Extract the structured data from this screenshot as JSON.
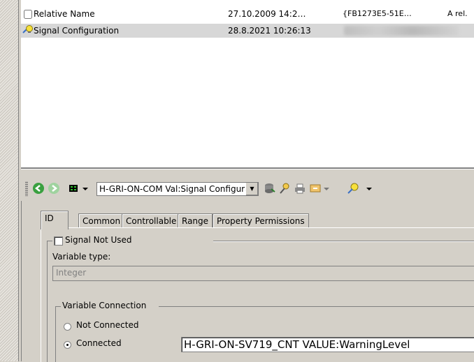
{
  "list": {
    "rows": [
      {
        "name": "Relative Name",
        "date": "27.10.2009 14:2…",
        "guid": "{FB1273E5-51E…",
        "desc": "A rel.",
        "icon": "document-icon"
      },
      {
        "name": "Signal Configuration",
        "date": "28.8.2021 10:26:13",
        "guid": "",
        "desc": "",
        "icon": "signal-config-icon"
      }
    ]
  },
  "toolbar": {
    "combo_value": "H-GRI-ON-COM Val:Signal Configurat",
    "icons": [
      "back-icon",
      "forward-icon",
      "grid-icon",
      "dropdown-arrow-icon",
      "stack-icon",
      "pin-icon",
      "printer-icon",
      "export-icon",
      "config-wand-icon"
    ]
  },
  "tabs": [
    {
      "label": "ID"
    },
    {
      "label": "Common"
    },
    {
      "label": "Controllable"
    },
    {
      "label": "Range"
    },
    {
      "label": "Property Permissions"
    }
  ],
  "panel": {
    "signal_not_used": "Signal Not Used",
    "variable_type_label": "Variable type:",
    "variable_type_value": "Integer",
    "variable_connection_label": "Variable Connection",
    "not_connected": "Not Connected",
    "connected": "Connected",
    "connection_value": "H-GRI-ON-SV719_CNT VALUE:WarningLevel"
  }
}
